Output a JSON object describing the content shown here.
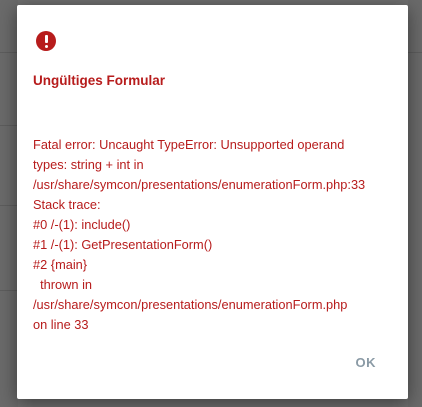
{
  "dialog": {
    "icon": "error-exclamation-icon",
    "title": "Ungültiges Formular",
    "message_lines": [
      "Fatal error: Uncaught TypeError: Unsupported operand",
      "types: string + int in",
      "/usr/share/symcon/presentations/enumerationForm.php:33",
      "Stack trace:",
      "#0 /-(1): include()",
      "#1 /-(1): GetPresentationForm()",
      "#2 {main}",
      "  thrown in",
      "/usr/share/symcon/presentations/enumerationForm.php",
      "on line 33"
    ],
    "ok_label": "OK"
  },
  "colors": {
    "error": "#b71c1c",
    "button_text": "#8a9aa5",
    "overlay": "#6e6e6e",
    "dialog_background": "#ffffff"
  }
}
